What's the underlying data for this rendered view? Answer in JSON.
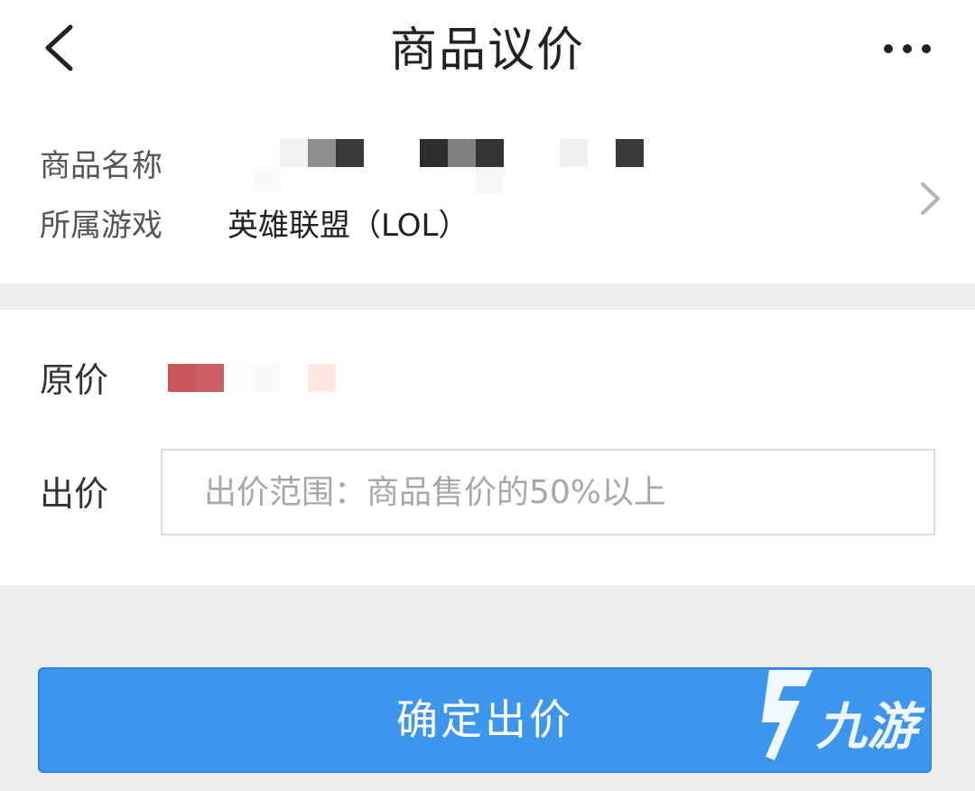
{
  "header": {
    "title": "商品议价",
    "back_icon": "chevron-left-icon",
    "more_icon": "more-horizontal-icon"
  },
  "product": {
    "name_label": "商品名称",
    "game_label": "所属游戏",
    "game_value": "英雄联盟（LOL）",
    "chevron_icon": "chevron-right-icon"
  },
  "pricing": {
    "original_label": "原价",
    "bid_label": "出价",
    "bid_placeholder": "出价范围：商品售价的50%以上",
    "bid_value": ""
  },
  "actions": {
    "confirm_label": "确定出价"
  },
  "watermark": {
    "text": "九游"
  },
  "colors": {
    "accent": "#3d96ee",
    "background": "#ededed",
    "card": "#ffffff",
    "placeholder": "#a8a8a8"
  }
}
